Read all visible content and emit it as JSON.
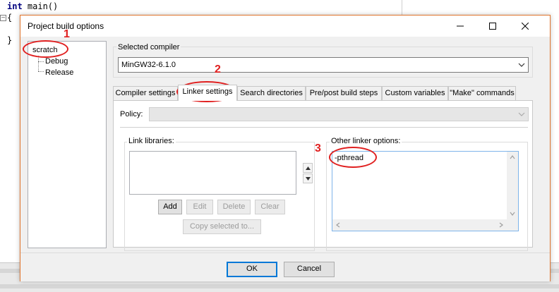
{
  "editor": {
    "line1_keyword": "int",
    "line1_rest": " main()",
    "line2": "{",
    "line3": "}"
  },
  "dialog": {
    "title": "Project build options",
    "controls": {
      "minimize_icon": "minimize-icon",
      "maximize_icon": "maximize-icon",
      "close_icon": "close-icon"
    }
  },
  "tree": {
    "root": "scratch",
    "children": [
      "Debug",
      "Release"
    ]
  },
  "compiler": {
    "group_label": "Selected compiler",
    "value": "MinGW32-6.1.0"
  },
  "tabs": [
    {
      "label": "Compiler settings",
      "active": false
    },
    {
      "label": "Linker settings",
      "active": true
    },
    {
      "label": "Search directories",
      "active": false
    },
    {
      "label": "Pre/post build steps",
      "active": false
    },
    {
      "label": "Custom variables",
      "active": false
    },
    {
      "label": "\"Make\" commands",
      "active": false
    }
  ],
  "linker": {
    "policy_label": "Policy:",
    "policy_value": "",
    "link_libraries_label": "Link libraries:",
    "other_options_label": "Other linker options:",
    "other_options_value": "-pthread",
    "buttons": {
      "add": "Add",
      "edit": "Edit",
      "delete": "Delete",
      "clear": "Clear",
      "copy_selected": "Copy selected to..."
    }
  },
  "footer": {
    "ok": "OK",
    "cancel": "Cancel"
  },
  "annotations": [
    "1",
    "2",
    "3"
  ],
  "colors": {
    "annotation": "#e02020",
    "dialog_border": "#e0752e",
    "focus_border": "#0078d7"
  }
}
